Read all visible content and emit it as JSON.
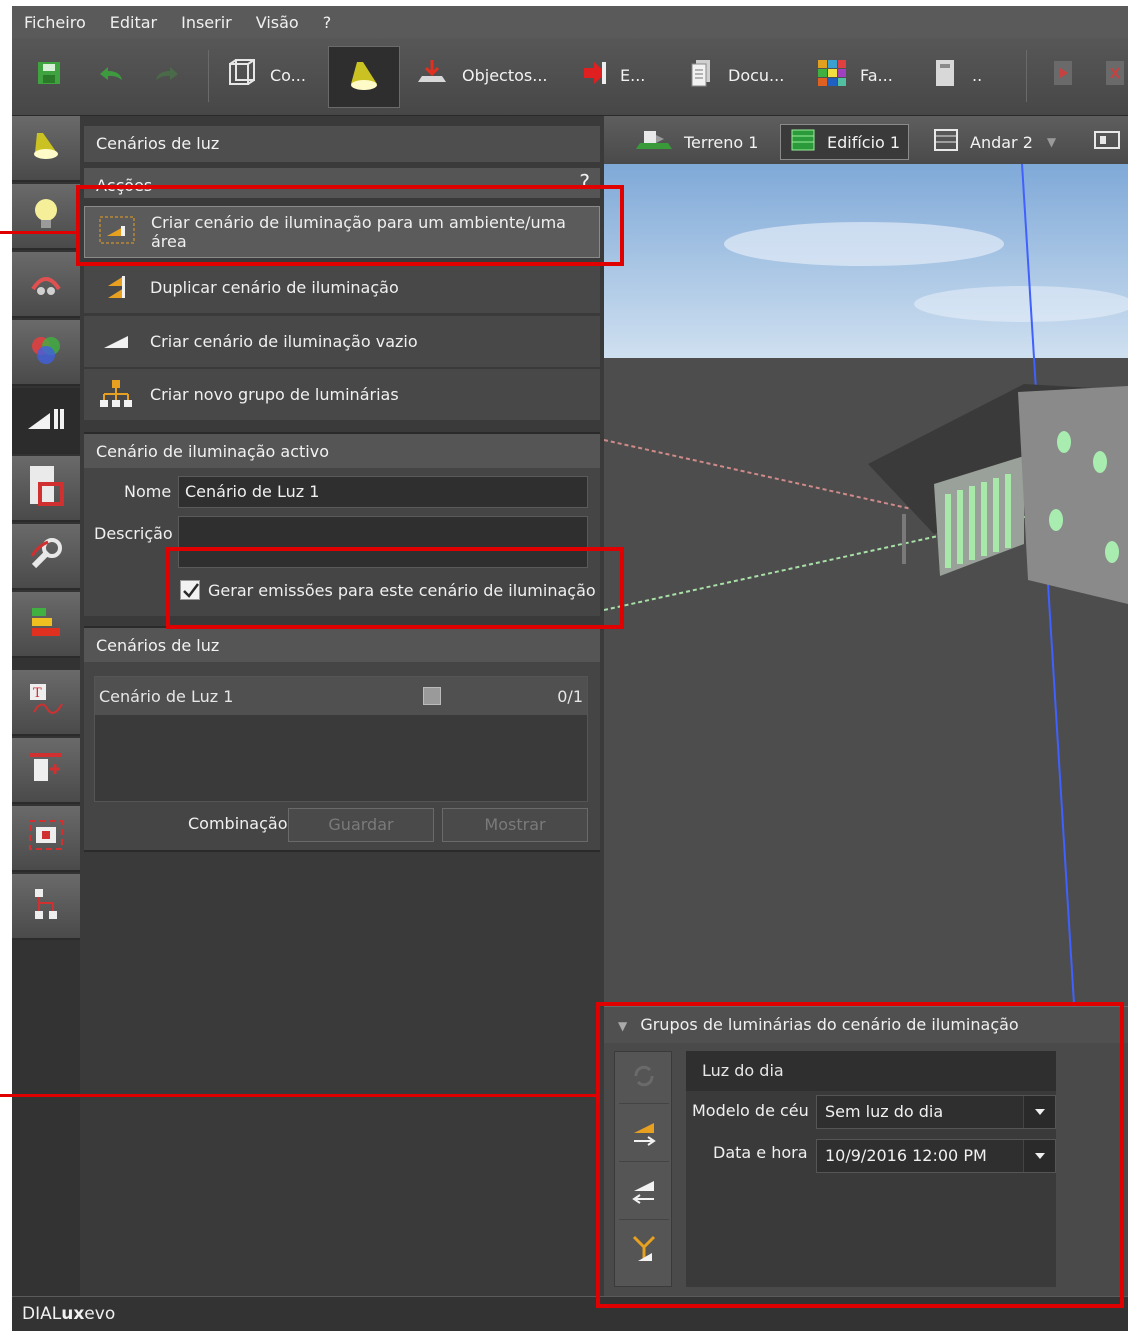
{
  "menubar": {
    "items": [
      "Ficheiro",
      "Editar",
      "Inserir",
      "Visão",
      "?"
    ]
  },
  "toolbar": {
    "items": [
      {
        "label": "Co...",
        "icon": "building-construction-icon"
      },
      {
        "label": "",
        "icon": "light-scenes-icon"
      },
      {
        "label": "Objectos...",
        "icon": "objects-icon"
      },
      {
        "label": "E...",
        "icon": "export-icon"
      },
      {
        "label": "Docu...",
        "icon": "documentation-icon"
      },
      {
        "label": "Fa...",
        "icon": "facade-icon"
      },
      {
        "label": "..",
        "icon": "door-icon"
      }
    ]
  },
  "left_tabs": [
    "lamp-icon",
    "bulb-icon",
    "tools-icon",
    "color-icon",
    "light-scene-tab-icon",
    "room-icon",
    "wrench-icon",
    "energy-icon",
    "text-curve-icon",
    "window-icon",
    "screen-icon",
    "hierarchy-icon"
  ],
  "panel": {
    "title": "Cenários de luz",
    "actions_header": "Acções",
    "help": "?",
    "actions": [
      "Criar cenário de iluminação para um ambiente/uma área",
      "Duplicar cenário de iluminação",
      "Criar cenário de iluminação vazio",
      "Criar novo grupo de luminárias"
    ],
    "active_header": "Cenário de iluminação activo",
    "name_label": "Nome",
    "name_value": "Cenário de Luz 1",
    "desc_label": "Descrição",
    "desc_value": "",
    "checkbox_label": "Gerar emissões para este cenário de iluminação",
    "scenes_header": "Cenários de luz",
    "scenes": [
      {
        "name": "Cenário de Luz 1",
        "count": "0/1"
      }
    ],
    "combination_label": "Combinação",
    "save_label": "Guardar",
    "show_label": "Mostrar"
  },
  "viewport": {
    "tabs": [
      {
        "label": "Terreno 1"
      },
      {
        "label": "Edifício 1"
      },
      {
        "label": "Andar 2"
      }
    ]
  },
  "groups": {
    "header": "Grupos de luminárias do cenário de iluminação",
    "daylight_title": "Luz do dia",
    "sky_label": "Modelo de céu",
    "sky_value": "Sem luz do dia",
    "datetime_label": "Data e hora",
    "datetime_value": "10/9/2016 12:00 PM"
  },
  "status": {
    "brand_pre": "DIAL",
    "brand_bold": "ux",
    "brand_post": "evo"
  },
  "colors": {
    "accent": "#e8a020",
    "highlight": "#e00000",
    "sky": "#8fb8e0"
  }
}
